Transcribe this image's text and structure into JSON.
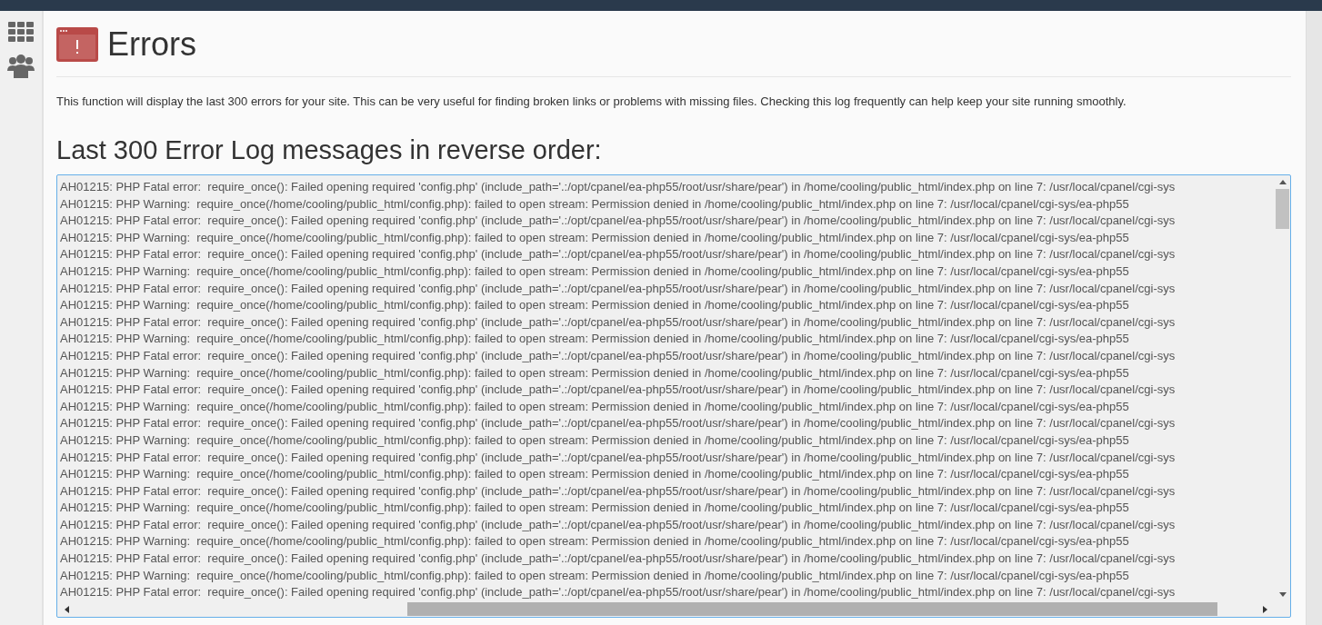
{
  "page": {
    "title": "Errors",
    "description": "This function will display the last 300 errors for your site. This can be very useful for finding broken links or problems with missing files. Checking this log frequently can help keep your site running smoothly."
  },
  "log": {
    "heading": "Last 300 Error Log messages in reverse order:",
    "lines": [
      "AH01215: PHP Fatal error:  require_once(): Failed opening required 'config.php' (include_path='.:/opt/cpanel/ea-php55/root/usr/share/pear') in /home/cooling/public_html/index.php on line 7: /usr/local/cpanel/cgi-sys",
      "AH01215: PHP Warning:  require_once(/home/cooling/public_html/config.php): failed to open stream: Permission denied in /home/cooling/public_html/index.php on line 7: /usr/local/cpanel/cgi-sys/ea-php55",
      "AH01215: PHP Fatal error:  require_once(): Failed opening required 'config.php' (include_path='.:/opt/cpanel/ea-php55/root/usr/share/pear') in /home/cooling/public_html/index.php on line 7: /usr/local/cpanel/cgi-sys",
      "AH01215: PHP Warning:  require_once(/home/cooling/public_html/config.php): failed to open stream: Permission denied in /home/cooling/public_html/index.php on line 7: /usr/local/cpanel/cgi-sys/ea-php55",
      "AH01215: PHP Fatal error:  require_once(): Failed opening required 'config.php' (include_path='.:/opt/cpanel/ea-php55/root/usr/share/pear') in /home/cooling/public_html/index.php on line 7: /usr/local/cpanel/cgi-sys",
      "AH01215: PHP Warning:  require_once(/home/cooling/public_html/config.php): failed to open stream: Permission denied in /home/cooling/public_html/index.php on line 7: /usr/local/cpanel/cgi-sys/ea-php55",
      "AH01215: PHP Fatal error:  require_once(): Failed opening required 'config.php' (include_path='.:/opt/cpanel/ea-php55/root/usr/share/pear') in /home/cooling/public_html/index.php on line 7: /usr/local/cpanel/cgi-sys",
      "AH01215: PHP Warning:  require_once(/home/cooling/public_html/config.php): failed to open stream: Permission denied in /home/cooling/public_html/index.php on line 7: /usr/local/cpanel/cgi-sys/ea-php55",
      "AH01215: PHP Fatal error:  require_once(): Failed opening required 'config.php' (include_path='.:/opt/cpanel/ea-php55/root/usr/share/pear') in /home/cooling/public_html/index.php on line 7: /usr/local/cpanel/cgi-sys",
      "AH01215: PHP Warning:  require_once(/home/cooling/public_html/config.php): failed to open stream: Permission denied in /home/cooling/public_html/index.php on line 7: /usr/local/cpanel/cgi-sys/ea-php55",
      "AH01215: PHP Fatal error:  require_once(): Failed opening required 'config.php' (include_path='.:/opt/cpanel/ea-php55/root/usr/share/pear') in /home/cooling/public_html/index.php on line 7: /usr/local/cpanel/cgi-sys",
      "AH01215: PHP Warning:  require_once(/home/cooling/public_html/config.php): failed to open stream: Permission denied in /home/cooling/public_html/index.php on line 7: /usr/local/cpanel/cgi-sys/ea-php55",
      "AH01215: PHP Fatal error:  require_once(): Failed opening required 'config.php' (include_path='.:/opt/cpanel/ea-php55/root/usr/share/pear') in /home/cooling/public_html/index.php on line 7: /usr/local/cpanel/cgi-sys",
      "AH01215: PHP Warning:  require_once(/home/cooling/public_html/config.php): failed to open stream: Permission denied in /home/cooling/public_html/index.php on line 7: /usr/local/cpanel/cgi-sys/ea-php55",
      "AH01215: PHP Fatal error:  require_once(): Failed opening required 'config.php' (include_path='.:/opt/cpanel/ea-php55/root/usr/share/pear') in /home/cooling/public_html/index.php on line 7: /usr/local/cpanel/cgi-sys",
      "AH01215: PHP Warning:  require_once(/home/cooling/public_html/config.php): failed to open stream: Permission denied in /home/cooling/public_html/index.php on line 7: /usr/local/cpanel/cgi-sys/ea-php55",
      "AH01215: PHP Fatal error:  require_once(): Failed opening required 'config.php' (include_path='.:/opt/cpanel/ea-php55/root/usr/share/pear') in /home/cooling/public_html/index.php on line 7: /usr/local/cpanel/cgi-sys",
      "AH01215: PHP Warning:  require_once(/home/cooling/public_html/config.php): failed to open stream: Permission denied in /home/cooling/public_html/index.php on line 7: /usr/local/cpanel/cgi-sys/ea-php55",
      "AH01215: PHP Fatal error:  require_once(): Failed opening required 'config.php' (include_path='.:/opt/cpanel/ea-php55/root/usr/share/pear') in /home/cooling/public_html/index.php on line 7: /usr/local/cpanel/cgi-sys",
      "AH01215: PHP Warning:  require_once(/home/cooling/public_html/config.php): failed to open stream: Permission denied in /home/cooling/public_html/index.php on line 7: /usr/local/cpanel/cgi-sys/ea-php55",
      "AH01215: PHP Fatal error:  require_once(): Failed opening required 'config.php' (include_path='.:/opt/cpanel/ea-php55/root/usr/share/pear') in /home/cooling/public_html/index.php on line 7: /usr/local/cpanel/cgi-sys",
      "AH01215: PHP Warning:  require_once(/home/cooling/public_html/config.php): failed to open stream: Permission denied in /home/cooling/public_html/index.php on line 7: /usr/local/cpanel/cgi-sys/ea-php55",
      "AH01215: PHP Fatal error:  require_once(): Failed opening required 'config.php' (include_path='.:/opt/cpanel/ea-php55/root/usr/share/pear') in /home/cooling/public_html/index.php on line 7: /usr/local/cpanel/cgi-sys",
      "AH01215: PHP Warning:  require_once(/home/cooling/public_html/config.php): failed to open stream: Permission denied in /home/cooling/public_html/index.php on line 7: /usr/local/cpanel/cgi-sys/ea-php55",
      "AH01215: PHP Fatal error:  require_once(): Failed opening required 'config.php' (include_path='.:/opt/cpanel/ea-php55/root/usr/share/pear') in /home/cooling/public_html/index.php on line 7: /usr/local/cpanel/cgi-sys"
    ]
  }
}
